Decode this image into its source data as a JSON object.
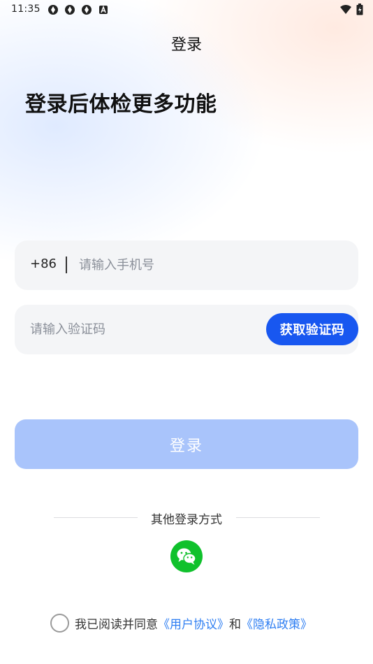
{
  "status_bar": {
    "time": "11:35",
    "left_icons": [
      "app-icon",
      "app-icon",
      "app-icon",
      "notification-a-icon"
    ],
    "right_icons": [
      "wifi-icon",
      "battery-icon"
    ]
  },
  "nav": {
    "title": "登录"
  },
  "headline": "登录后体检更多功能",
  "phone_field": {
    "country_code": "+86",
    "placeholder": "请输入手机号",
    "value": ""
  },
  "code_field": {
    "placeholder": "请输入验证码",
    "value": "",
    "get_code_label": "获取验证码"
  },
  "login_button": {
    "label": "登录"
  },
  "other_login": {
    "label": "其他登录方式",
    "options": [
      "wechat-icon"
    ]
  },
  "agreement": {
    "prefix": "我已阅读并同意",
    "user_agreement": "《用户协议》",
    "conjunction": "和",
    "privacy_policy": "《隐私政策》",
    "checked": false
  },
  "colors": {
    "primary": "#1857f0",
    "login_disabled": "#a9c4fb",
    "link": "#2e7ef2",
    "wechat": "#10c12c",
    "field_bg": "#f4f5f7"
  }
}
